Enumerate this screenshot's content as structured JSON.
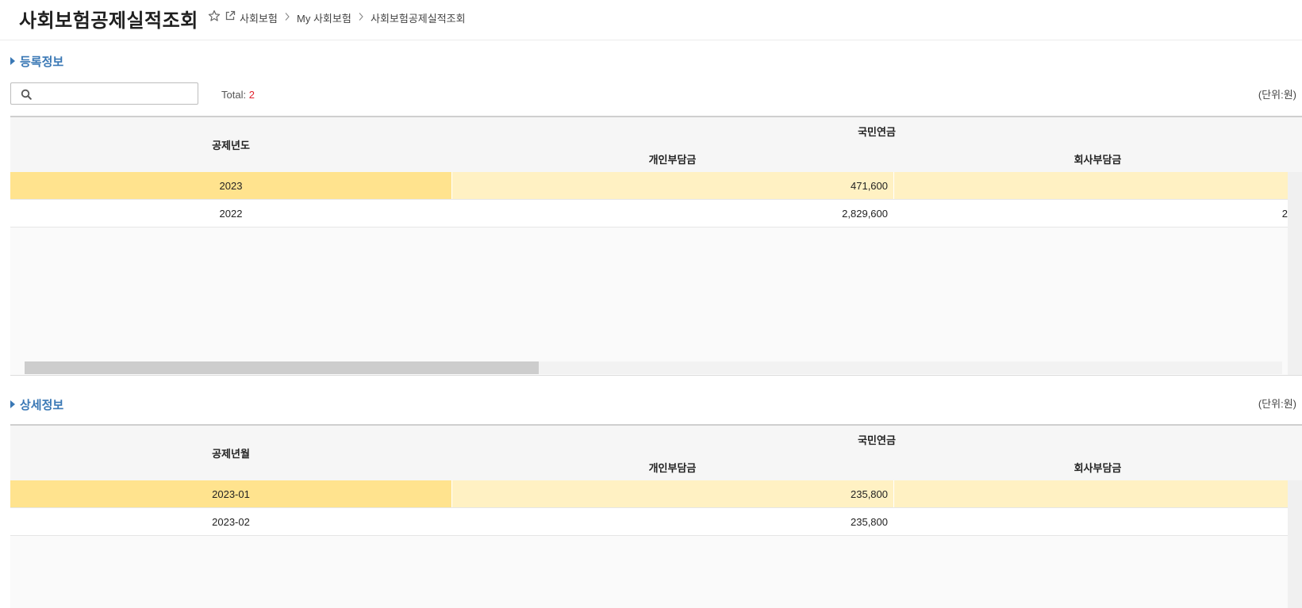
{
  "header": {
    "title": "사회보험공제실적조회",
    "breadcrumb": [
      "사회보험",
      "My 사회보험",
      "사회보험공제실적조회"
    ]
  },
  "registration": {
    "section_title": "등록정보",
    "search": {
      "value": "",
      "placeholder": ""
    },
    "total_label": "Total:",
    "total_count": "2",
    "unit": "(단위:원)",
    "columns": {
      "year": "공제년도",
      "group": "국민연금",
      "personal": "개인부담금",
      "company": "회사부담금"
    },
    "rows": [
      {
        "year": "2023",
        "personal": "471,600",
        "company": ""
      },
      {
        "year": "2022",
        "personal": "2,829,600",
        "company": "2"
      }
    ]
  },
  "detail": {
    "section_title": "상세정보",
    "unit": "(단위:원)",
    "columns": {
      "month": "공제년월",
      "group": "국민연금",
      "personal": "개인부담금",
      "company": "회사부담금"
    },
    "rows": [
      {
        "month": "2023-01",
        "personal": "235,800",
        "company": ""
      },
      {
        "month": "2023-02",
        "personal": "235,800",
        "company": ""
      }
    ]
  },
  "colors": {
    "accent": "#3a78b5",
    "selected_row": "#ffe38e",
    "selected_row_light": "#fff1c3",
    "total_count": "#e0222e"
  }
}
